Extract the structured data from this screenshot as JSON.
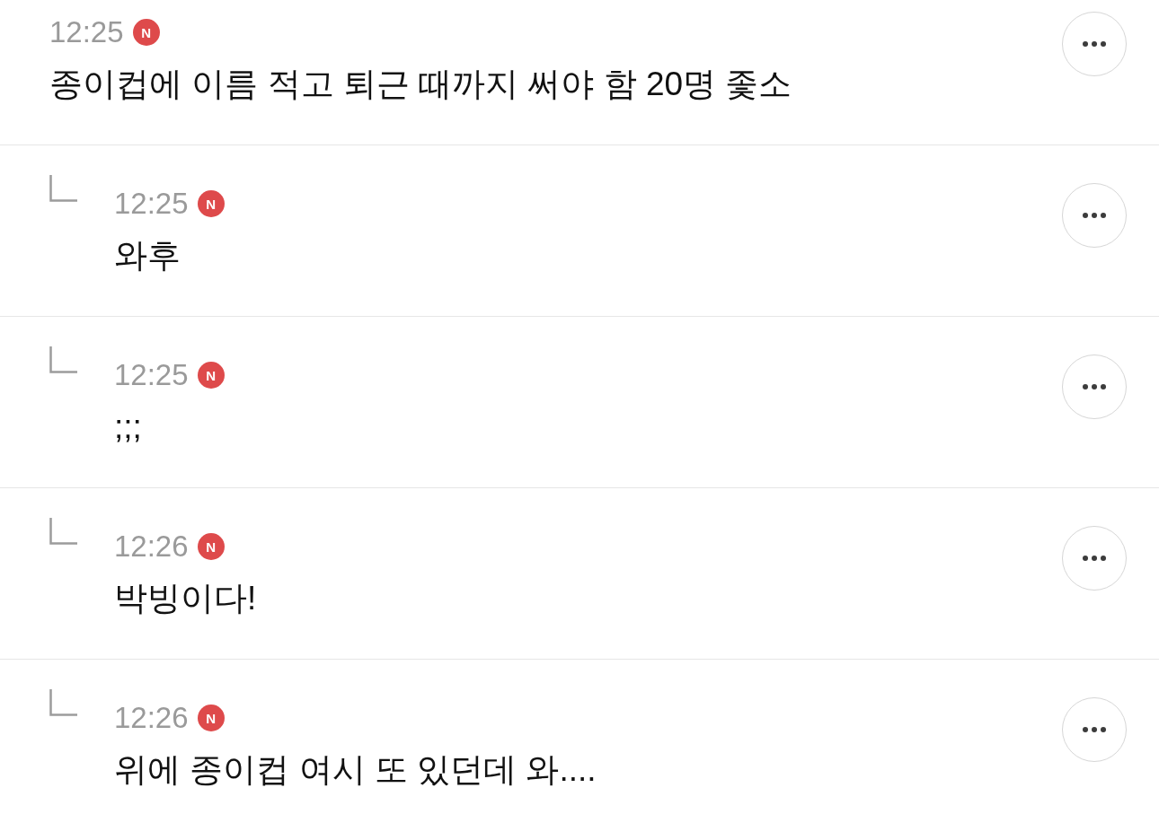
{
  "comments": [
    {
      "time": "12:25",
      "badge": "N",
      "text": "종이컵에 이름 적고 퇴근 때까지 써야 함 20명 좇소",
      "replies": [
        {
          "time": "12:25",
          "badge": "N",
          "text": "와후"
        },
        {
          "time": "12:25",
          "badge": "N",
          "text": ";;;"
        },
        {
          "time": "12:26",
          "badge": "N",
          "text": "박빙이다!"
        },
        {
          "time": "12:26",
          "badge": "N",
          "text": "위에 종이컵 여시 또 있던데 와...."
        }
      ]
    }
  ]
}
